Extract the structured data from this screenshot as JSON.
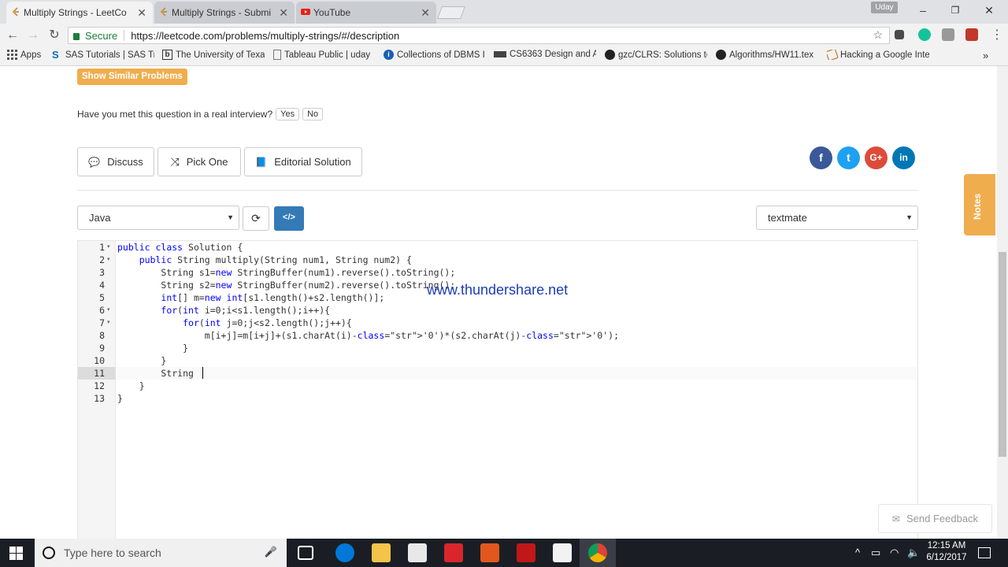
{
  "browser": {
    "tabs": [
      {
        "title": "Multiply Strings - LeetCo",
        "favicon": "leetcode-icon",
        "active": true
      },
      {
        "title": "Multiply Strings - Submis",
        "favicon": "leetcode-icon",
        "active": false
      },
      {
        "title": "YouTube",
        "favicon": "youtube-icon",
        "active": false
      }
    ],
    "user": "Uday",
    "secure_label": "Secure",
    "url": "https://leetcode.com/problems/multiply-strings/#/description",
    "bookmarks": [
      {
        "label": "Apps",
        "icon": "apps-grid-icon"
      },
      {
        "label": "SAS Tutorials | SAS Tra",
        "icon": "sas-icon"
      },
      {
        "label": "The University of Texa",
        "icon": "utd-icon"
      },
      {
        "label": "Tableau Public | uday",
        "icon": "page-icon"
      },
      {
        "label": "Collections of DBMS I",
        "icon": "info-icon"
      },
      {
        "label": "CS6363 Design and A",
        "icon": "bookmark-icon"
      },
      {
        "label": "gzc/CLRS: Solutions to",
        "icon": "github-icon"
      },
      {
        "label": "Algorithms/HW11.tex",
        "icon": "github-icon"
      },
      {
        "label": "Hacking a Google Inte",
        "icon": "hacking-icon"
      }
    ]
  },
  "page": {
    "similar_button": "Show Similar Problems",
    "interview_question": "Have you met this question in a real interview?",
    "yes_label": "Yes",
    "no_label": "No",
    "discuss_label": "Discuss",
    "pick_one_label": "Pick One",
    "editorial_label": "Editorial Solution",
    "language": "Java",
    "theme": "textmate",
    "notes_label": "Notes",
    "feedback_label": "Send Feedback",
    "watermark": "www.thundershare.net"
  },
  "editor": {
    "lines": [
      {
        "n": "1",
        "fold": true,
        "code": "public class Solution {"
      },
      {
        "n": "2",
        "fold": true,
        "code": "    public String multiply(String num1, String num2) {"
      },
      {
        "n": "3",
        "fold": false,
        "code": "        String s1=new StringBuffer(num1).reverse().toString();"
      },
      {
        "n": "4",
        "fold": false,
        "code": "        String s2=new StringBuffer(num2).reverse().toString();"
      },
      {
        "n": "5",
        "fold": false,
        "code": "        int[] m=new int[s1.length()+s2.length()];"
      },
      {
        "n": "6",
        "fold": true,
        "code": "        for(int i=0;i<s1.length();i++){"
      },
      {
        "n": "7",
        "fold": true,
        "code": "            for(int j=0;j<s2.length();j++){"
      },
      {
        "n": "8",
        "fold": false,
        "code": "                m[i+j]=m[i+j]+(s1.charAt(i)-'0')*(s2.charAt(j)-'0');"
      },
      {
        "n": "9",
        "fold": false,
        "code": "            }"
      },
      {
        "n": "10",
        "fold": false,
        "code": "        }"
      },
      {
        "n": "11",
        "fold": false,
        "code": "        String "
      },
      {
        "n": "12",
        "fold": false,
        "code": "    }"
      },
      {
        "n": "13",
        "fold": false,
        "code": "}"
      }
    ]
  },
  "taskbar": {
    "search_placeholder": "Type here to search",
    "time": "12:15 AM",
    "date": "6/12/2017"
  },
  "colors": {
    "accent_orange": "#f0ad4e",
    "primary_blue": "#337ab7",
    "facebook": "#3b5998",
    "twitter": "#1da1f2",
    "google_plus": "#dd4b39",
    "linkedin": "#0077b5"
  }
}
